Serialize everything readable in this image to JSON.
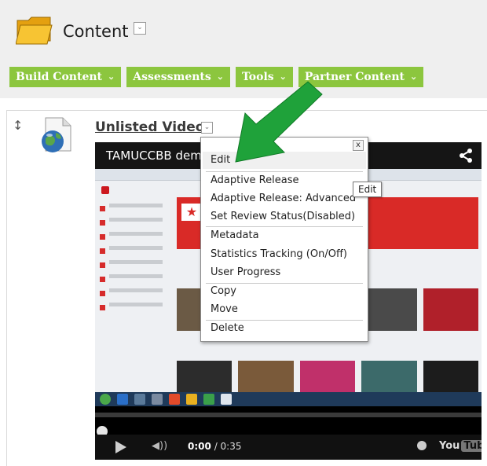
{
  "page": {
    "title": "Content"
  },
  "toolbar": {
    "buttons": [
      {
        "label": "Build Content"
      },
      {
        "label": "Assessments"
      },
      {
        "label": "Tools"
      },
      {
        "label": "Partner Content"
      }
    ]
  },
  "item": {
    "title": "Unlisted Video"
  },
  "video": {
    "title": "TAMUCCBB demo",
    "time_current": "0:00",
    "time_total": "/ 0:35",
    "brand": "You",
    "brand_tube": "Tube",
    "progress": 0.0
  },
  "menu": {
    "close": "x",
    "items": [
      {
        "label": "Edit"
      },
      {
        "label": "Adaptive Release"
      },
      {
        "label": "Adaptive Release: Advanced"
      },
      {
        "label": "Set Review Status(Disabled)"
      },
      {
        "label": "Metadata"
      },
      {
        "label": "Statistics Tracking (On/Off)"
      },
      {
        "label": "User Progress"
      },
      {
        "label": "Copy"
      },
      {
        "label": "Move"
      },
      {
        "label": "Delete"
      }
    ]
  },
  "tooltip": {
    "text": "Edit"
  },
  "colors": {
    "toolbar_green": "#8cc63e",
    "arrow_green": "#1fa23a",
    "header_bg": "#efefef",
    "folder": "#f2b418"
  }
}
